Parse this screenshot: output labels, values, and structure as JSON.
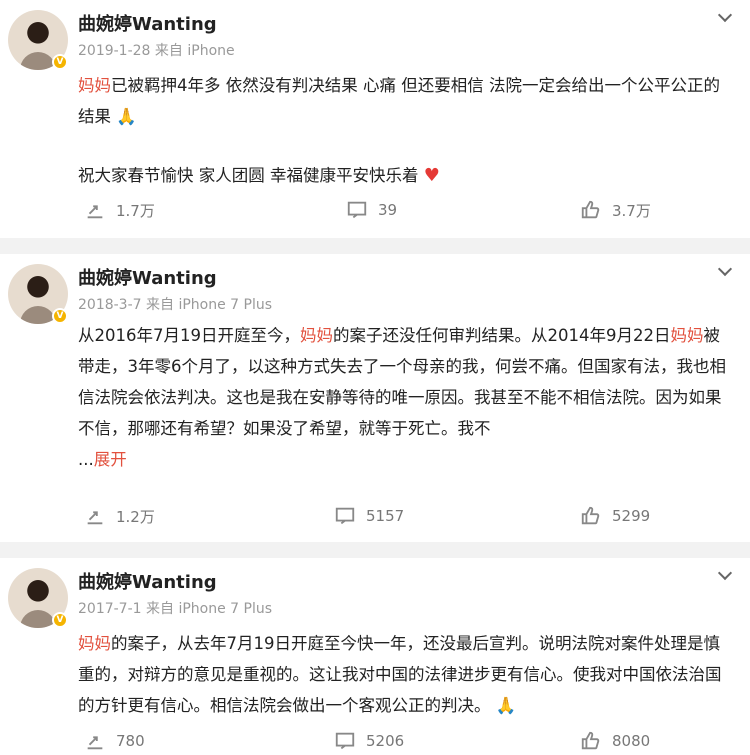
{
  "posts": [
    {
      "name": "曲婉婷Wanting",
      "date": "2019-1-28",
      "source": "来自 iPhone",
      "content_hl1": "妈妈",
      "content_p1": "已被羁押4年多 依然没有判决结果 心痛 但还要相信 法院一定会给出一个公平公正的结果",
      "content_p2": "祝大家春节愉快 家人团圆 幸福健康平安快乐着",
      "emoji1": "🙏",
      "emoji2": "♥",
      "repost": "1.7万",
      "comment": "39",
      "like": "3.7万"
    },
    {
      "name": "曲婉婷Wanting",
      "date": "2018-3-7",
      "source": "来自 iPhone 7 Plus",
      "content_a": "从2016年7月19日开庭至今，",
      "content_hl1": "妈妈",
      "content_b": "的案子还没任何审判结果。从2014年9月22日",
      "content_hl2": "妈妈",
      "content_c": "被带走，3年零6个月了，以这种方式失去了一个母亲的我，何尝不痛。但国家有法，我也相信法院会依法判决。这也是我在安静等待的唯一原因。我甚至不能不相信法院。因为如果不信，那哪还有希望？如果没了希望，就等于死亡。我不",
      "ellipsis": "...",
      "expand": "展开",
      "repost": "1.2万",
      "comment": "5157",
      "like": "5299"
    },
    {
      "name": "曲婉婷Wanting",
      "date": "2017-7-1",
      "source": "来自 iPhone 7 Plus",
      "content_hl1": "妈妈",
      "content_a": "的案子，从去年7月19日开庭至今快一年，还没最后宣判。说明法院对案件处理是慎重的，对辩方的意见是重视的。这让我对中国的法律进步更有信心。使我对中国依法治国的方针更有信心。相信法院会做出一个客观公正的判决。",
      "emoji1": "🙏",
      "repost": "780",
      "comment": "5206",
      "like": "8080"
    }
  ],
  "icons": {
    "verified": "V"
  }
}
